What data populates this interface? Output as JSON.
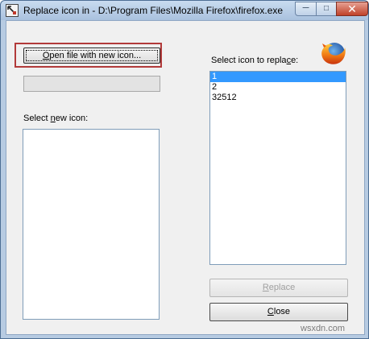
{
  "window": {
    "title": "Replace icon in - D:\\Program Files\\Mozilla Firefox\\firefox.exe",
    "minimize_label": "─",
    "maximize_label": "□",
    "close_label": "✕"
  },
  "left_panel": {
    "open_button": {
      "pre": "O",
      "rest": "pen file with new icon..."
    },
    "path_value": "",
    "select_new_label": {
      "pre": "Select ",
      "u": "n",
      "post": "ew icon:"
    },
    "new_icons": []
  },
  "right_panel": {
    "select_replace_label": {
      "pre": "Select icon to repla",
      "u": "c",
      "post": "e:"
    },
    "icons": [
      "1",
      "2",
      "32512"
    ],
    "selected_index": 0,
    "replace_button": {
      "u": "R",
      "rest": "eplace",
      "enabled": false
    },
    "close_button": {
      "u": "C",
      "rest": "lose"
    }
  },
  "colors": {
    "highlight_box": "#b23a3a",
    "selection": "#3399ff",
    "dialog_bg": "#f0f0f0"
  },
  "icons": {
    "app": "replace-icon-tool-icon",
    "logo": "firefox-logo-icon"
  },
  "watermark": "wsxdn.com"
}
